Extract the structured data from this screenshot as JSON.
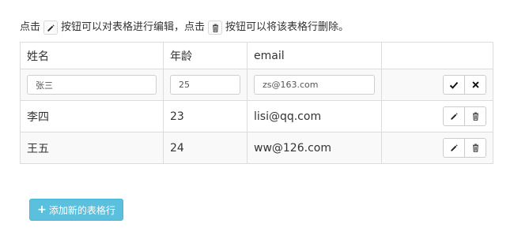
{
  "instruction": {
    "part1": "点击",
    "part2": "按钮可以对表格进行编辑，点击",
    "part3": "按钮可以将该表格行删除。",
    "edit_icon": "pencil-icon",
    "delete_icon": "trash-icon"
  },
  "table": {
    "headers": {
      "name": "姓名",
      "age": "年龄",
      "email": "email",
      "actions": ""
    },
    "editing_row": {
      "name": "张三",
      "age": "25",
      "email": "zs@163.com"
    },
    "rows": [
      {
        "name": "李四",
        "age": "23",
        "email": "lisi@qq.com"
      },
      {
        "name": "王五",
        "age": "24",
        "email": "ww@126.com"
      }
    ]
  },
  "add_button": {
    "label": "添加新的表格行",
    "icon": "plus-icon",
    "color": "#5bc0de"
  }
}
